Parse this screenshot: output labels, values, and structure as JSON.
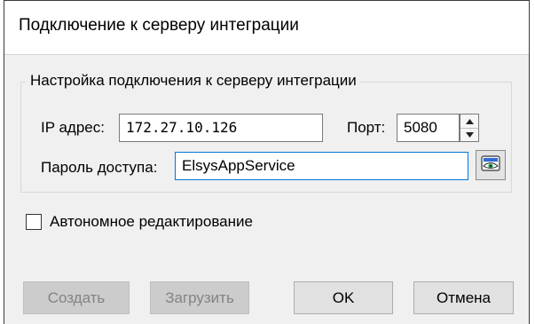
{
  "dialog": {
    "title": "Подключение к серверу интеграции"
  },
  "connection_group": {
    "legend": "Настройка подключения к серверу интеграции",
    "ip_label": "IP адрес:",
    "ip_value": "172.27.10.126",
    "port_label": "Порт:",
    "port_value": "5080",
    "password_label": "Пароль доступа:",
    "password_value": "ElsysAppService"
  },
  "offline_edit": {
    "label": "Автономное редактирование",
    "checked": false
  },
  "buttons": {
    "create": "Создать",
    "load": "Загрузить",
    "ok": "OK",
    "cancel": "Отмена"
  },
  "icons": {
    "spin_up": "triangle-up-icon",
    "spin_down": "triangle-down-icon",
    "show_password": "eye-icon"
  },
  "colors": {
    "accent": "#0078d7",
    "dialog_bg": "#f0f0f0",
    "disabled_text": "#838383"
  }
}
